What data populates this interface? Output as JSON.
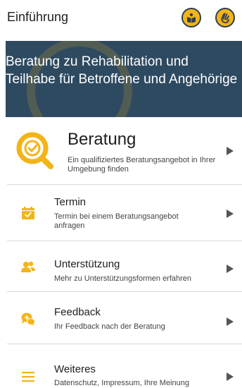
{
  "header": {
    "title": "Einführung",
    "book_icon": "book-reader-icon",
    "sign_icon": "sign-language-icon"
  },
  "hero": {
    "text": "Beratung zu Rehabilitation und Teilhabe für Betroffene und Angehörige"
  },
  "colors": {
    "accent": "#f2b417",
    "hero_bg": "#2e4a61",
    "text": "#1e1e1e"
  },
  "menu": {
    "main": {
      "label": "Beratung",
      "sub": "Ein qualifiziertes Beratungsangebot in Ihrer Umgebung finden",
      "icon": "search-check-icon"
    },
    "items": [
      {
        "label": "Termin",
        "sub": "Termin bei einem Beratungsangebot anfragen",
        "icon": "calendar-check-icon"
      },
      {
        "label": "Unterstützung",
        "sub": "Mehr zu Unterstützungsformen erfahren",
        "icon": "people-icon"
      },
      {
        "label": "Feedback",
        "sub": "Ihr Feedback nach der Beratung",
        "icon": "chat-bubbles-icon"
      },
      {
        "label": "Weiteres",
        "sub": "Datenschutz, Impressum, Ihre Meinung",
        "icon": "menu-lines-icon"
      }
    ]
  }
}
